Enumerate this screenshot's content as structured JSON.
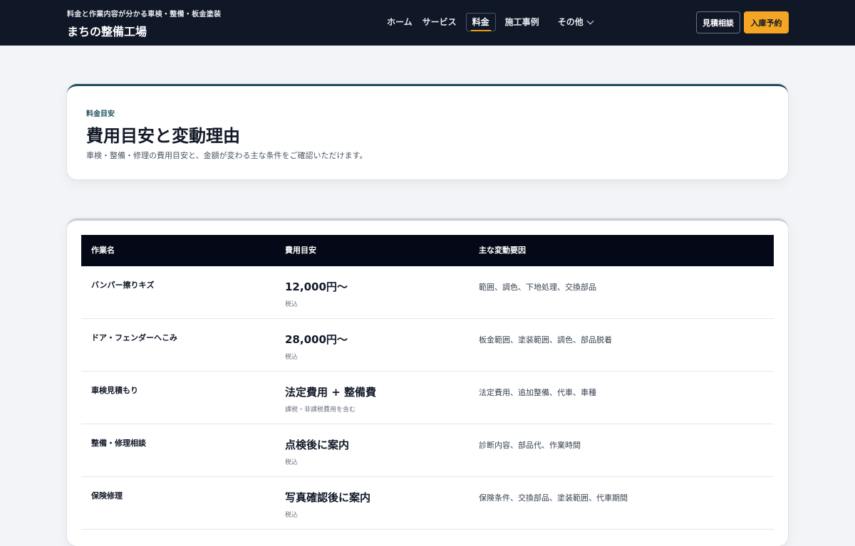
{
  "header": {
    "tagline": "料金と作業内容が分かる車検・整備・板金塗装",
    "site_name": "まちの整備工場",
    "nav": [
      {
        "label": "ホーム",
        "active": false
      },
      {
        "label": "サービス",
        "active": false
      },
      {
        "label": "料金",
        "active": true
      },
      {
        "label": "施工事例",
        "active": false
      },
      {
        "label": "その他",
        "active": false,
        "dropdown": true
      }
    ],
    "consult_label": "見積相談",
    "reserve_label": "入庫予約",
    "colors": {
      "header_bg": "#101828",
      "accent": "#f5a524"
    }
  },
  "hero": {
    "eyebrow": "料金目安",
    "title": "費用目安と変動理由",
    "description": "車検・整備・修理の費用目安と、金額が変わる主な条件をご確認いただけます。"
  },
  "table": {
    "headers": [
      "作業名",
      "費用目安",
      "主な変動要因"
    ],
    "rows": [
      {
        "name": "バンパー擦りキズ",
        "cost": "12,000円〜",
        "note": "税込",
        "factors": "範囲、調色、下地処理、交換部品"
      },
      {
        "name": "ドア・フェンダーへこみ",
        "cost": "28,000円〜",
        "note": "税込",
        "factors": "板金範囲、塗装範囲、調色、部品脱着"
      },
      {
        "name": "車検見積もり",
        "cost": "法定費用 + 整備費",
        "note": "課税・非課税費用を含む",
        "factors": "法定費用、追加整備、代車、車種"
      },
      {
        "name": "整備・修理相談",
        "cost": "点検後に案内",
        "note": "税込",
        "factors": "診断内容、部品代、作業時間"
      },
      {
        "name": "保険修理",
        "cost": "写真確認後に案内",
        "note": "税込",
        "factors": "保険条件、交換部品、塗装範囲、代車期間"
      }
    ]
  }
}
